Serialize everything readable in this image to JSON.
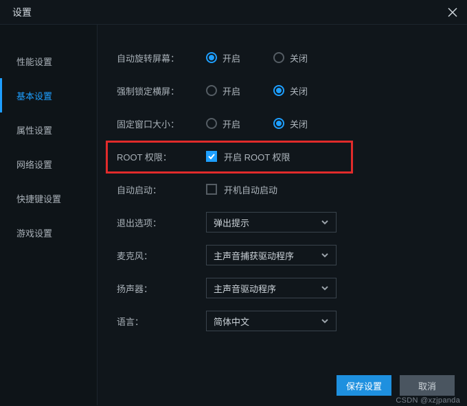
{
  "title": "设置",
  "sidebar": {
    "items": [
      {
        "label": "性能设置"
      },
      {
        "label": "基本设置"
      },
      {
        "label": "属性设置"
      },
      {
        "label": "网络设置"
      },
      {
        "label": "快捷键设置"
      },
      {
        "label": "游戏设置"
      }
    ],
    "activeIndex": 1
  },
  "settings": {
    "autorotate": {
      "label": "自动旋转屏幕：",
      "on": "开启",
      "off": "关闭",
      "value": "on"
    },
    "forceland": {
      "label": "强制锁定横屏：",
      "on": "开启",
      "off": "关闭",
      "value": "off"
    },
    "fixedsize": {
      "label": "固定窗口大小：",
      "on": "开启",
      "off": "关闭",
      "value": "off"
    },
    "root": {
      "label": "ROOT 权限：",
      "text": "开启 ROOT 权限",
      "checked": true
    },
    "autostart": {
      "label": "自动启动：",
      "text": "开机自动启动",
      "checked": false
    },
    "exit": {
      "label": "退出选项：",
      "value": "弹出提示"
    },
    "mic": {
      "label": "麦克风：",
      "value": "主声音捕获驱动程序"
    },
    "speaker": {
      "label": "扬声器：",
      "value": "主声音驱动程序"
    },
    "lang": {
      "label": "语言：",
      "value": "简体中文"
    }
  },
  "footer": {
    "save": "保存设置",
    "cancel": "取消"
  },
  "watermark": "CSDN @xzjpanda"
}
